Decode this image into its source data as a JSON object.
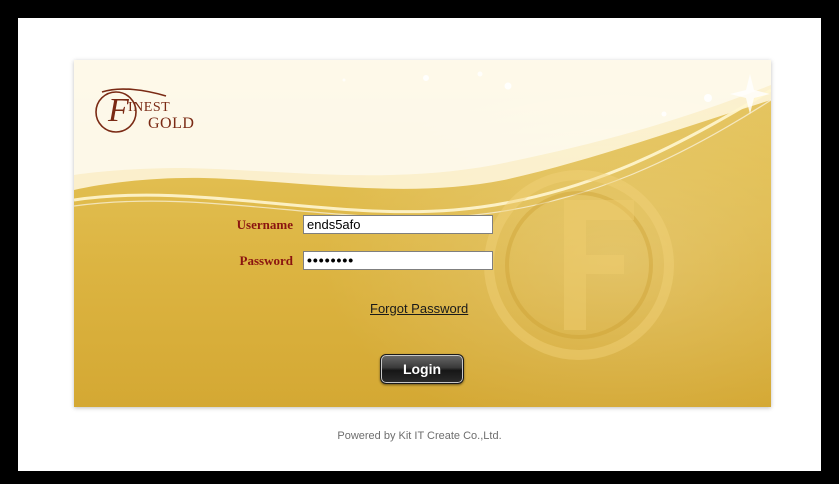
{
  "logo": {
    "line1": "INEST",
    "line2": "GOLD",
    "initial": "F"
  },
  "form": {
    "username_label": "Username",
    "username_value": "ends5afo",
    "password_label": "Password",
    "password_value": "••••••••",
    "forgot_link": "Forgot Password",
    "login_button": "Login"
  },
  "footer": {
    "text": "Powered by Kit IT Create Co.,Ltd."
  },
  "colors": {
    "label": "#8a1410",
    "panel_gold": "#dcb441",
    "button_dark": "#2c2c2c"
  }
}
